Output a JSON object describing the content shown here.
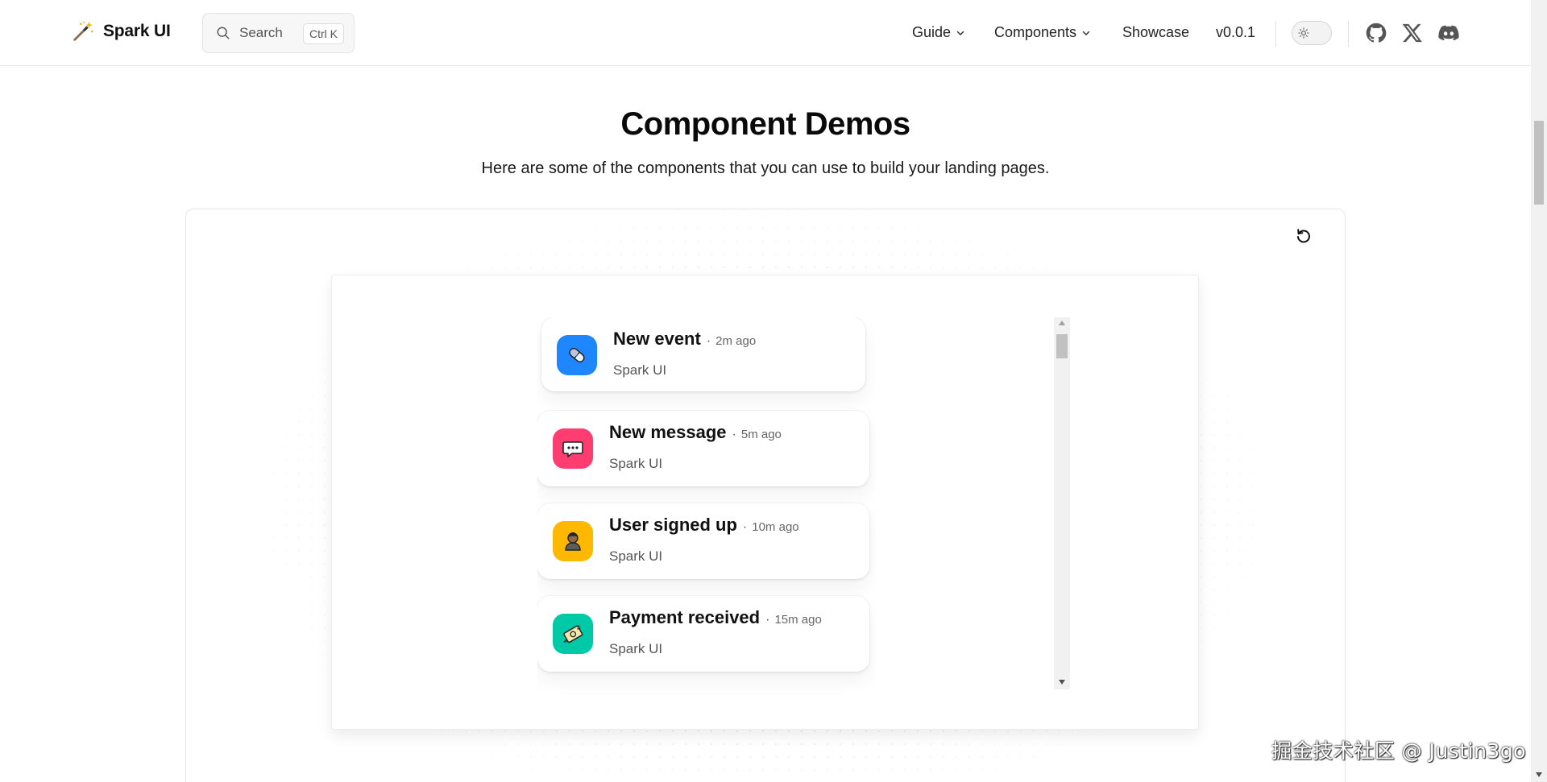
{
  "header": {
    "brand_name": "Spark UI",
    "search_placeholder": "Search",
    "search_shortcut": "Ctrl K",
    "nav": {
      "guide": "Guide",
      "components": "Components",
      "showcase": "Showcase",
      "version": "v0.0.1"
    },
    "icons": [
      "magic-wand-icon",
      "search-icon",
      "chevron-down-icon",
      "sun-icon",
      "github-icon",
      "x-icon",
      "discord-icon"
    ]
  },
  "main": {
    "title": "Component Demos",
    "subtitle": "Here are some of the components that you can use to build your landing pages."
  },
  "demo": {
    "notifications": [
      {
        "title": "New event",
        "time": "2m ago",
        "source": "Spark UI",
        "icon": "pill-icon",
        "color": "#1e86ff"
      },
      {
        "title": "New message",
        "time": "5m ago",
        "source": "Spark UI",
        "icon": "chat-icon",
        "color": "#ff3d71"
      },
      {
        "title": "User signed up",
        "time": "10m ago",
        "source": "Spark UI",
        "icon": "user-icon",
        "color": "#ffb800"
      },
      {
        "title": "Payment received",
        "time": "15m ago",
        "source": "Spark UI",
        "icon": "money-icon",
        "color": "#00c9a7"
      }
    ]
  },
  "watermark": "掘金技术社区 @ Justin3go"
}
